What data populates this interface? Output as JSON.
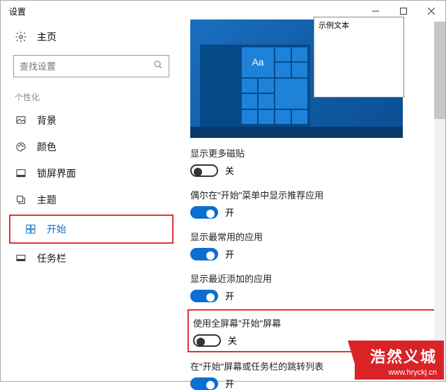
{
  "window_title": "设置",
  "header": {
    "home_label": "主页"
  },
  "search": {
    "placeholder": "查找设置"
  },
  "section_label": "个性化",
  "sidebar": {
    "items": [
      {
        "label": "背景",
        "icon": "image-icon"
      },
      {
        "label": "颜色",
        "icon": "palette-icon"
      },
      {
        "label": "锁屏界面",
        "icon": "lock-screen-icon"
      },
      {
        "label": "主题",
        "icon": "theme-icon"
      },
      {
        "label": "开始",
        "icon": "start-icon",
        "selected": true,
        "highlighted": true
      },
      {
        "label": "任务栏",
        "icon": "taskbar-icon"
      }
    ]
  },
  "preview": {
    "overlay_title": "示例文本",
    "tile_sample_text": "Aa"
  },
  "settings": [
    {
      "label": "显示更多磁贴",
      "state": "off",
      "text": "关"
    },
    {
      "label": "偶尔在\"开始\"菜单中显示推荐应用",
      "state": "on",
      "text": "开"
    },
    {
      "label": "显示最常用的应用",
      "state": "on",
      "text": "开"
    },
    {
      "label": "显示最近添加的应用",
      "state": "on",
      "text": "开"
    },
    {
      "label": "使用全屏幕\"开始\"屏幕",
      "state": "off",
      "text": "关",
      "highlighted": true
    },
    {
      "label": "在\"开始\"屏幕或任务栏的跳转列表",
      "state": "on",
      "text": "开"
    }
  ],
  "watermark": {
    "title": "浩然义城",
    "url": "www.hryckj.cn"
  }
}
